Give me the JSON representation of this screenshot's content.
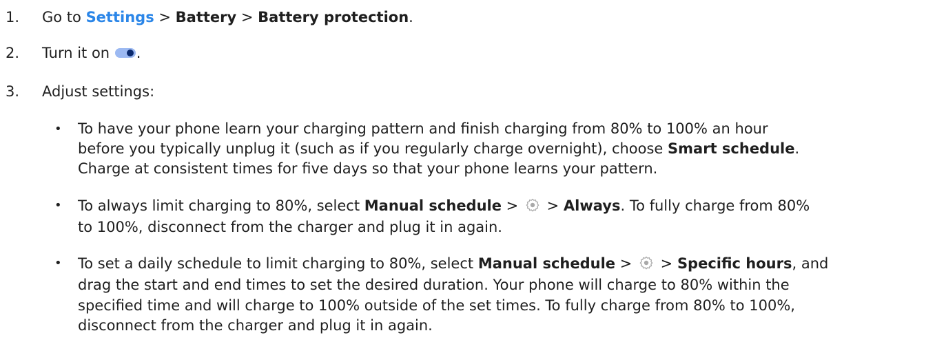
{
  "steps": [
    {
      "number": "1.",
      "parts": {
        "go_to": "Go to ",
        "settings": "Settings",
        "sep1": " > ",
        "battery": "Battery",
        "sep2": " > ",
        "battery_protection": "Battery protection",
        "end": "."
      }
    },
    {
      "number": "2.",
      "parts": {
        "turn_on": "Turn it on ",
        "end": "."
      },
      "icon": "toggle-on-icon"
    },
    {
      "number": "3.",
      "parts": {
        "text": "Adjust settings:"
      }
    }
  ],
  "bullets": [
    {
      "dot": "•",
      "line1": "To have your phone learn your charging pattern and finish charging from 80% to 100% an hour",
      "line2_pre": "before you typically unplug it (such as if you regularly charge overnight), choose ",
      "line2_bold": "Smart schedule",
      "line2_end": ".",
      "line3": "Charge at consistent times for five days so that your phone learns your pattern."
    },
    {
      "dot": "•",
      "pre": "To always limit charging to 80%, select ",
      "bold1": "Manual schedule",
      "sep1": " > ",
      "icon": "gear-icon",
      "sep2": " > ",
      "bold2": "Always",
      "post": ". To fully charge from 80%",
      "line2": "to 100%, disconnect from the charger and plug it in again."
    },
    {
      "dot": "•",
      "pre": "To set a daily schedule to limit charging to 80%, select ",
      "bold1": "Manual schedule",
      "sep1": " > ",
      "icon": "gear-icon",
      "sep2": " > ",
      "bold2": "Specific hours",
      "post": ", and",
      "line2": "drag the start and end times to set the desired duration. Your phone will charge to 80% within the",
      "line3": "specified time and will charge to 100% outside of the set times. To fully charge from 80% to 100%,",
      "line4": "disconnect from the charger and plug it in again."
    }
  ],
  "colors": {
    "link": "#2b86e8",
    "text": "#1f1f1f",
    "toggle_track": "#9cb9f2",
    "toggle_knob": "#0b2a6e",
    "gear": "#a9a9a9"
  }
}
